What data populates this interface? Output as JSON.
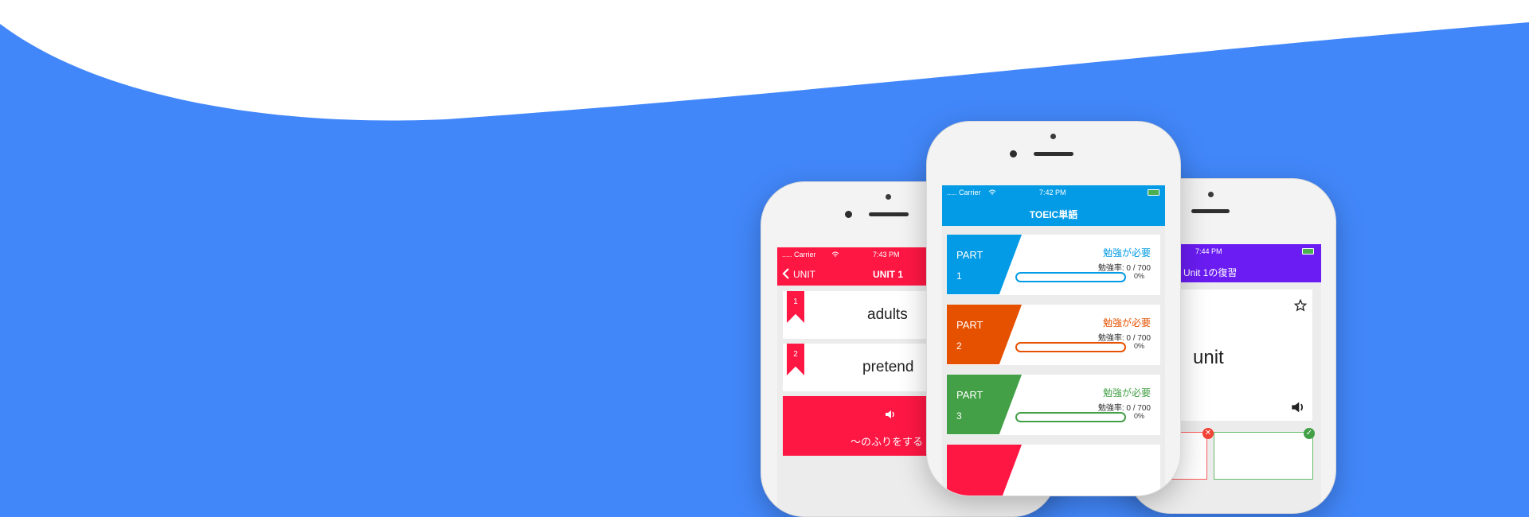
{
  "left_phone": {
    "status": {
      "carrier": "..... Carrier",
      "time": "7:43 PM"
    },
    "nav": {
      "back_label": "UNIT",
      "title": "UNIT 1",
      "color": "#ff1744"
    },
    "words": [
      {
        "number": "1",
        "word": "adults"
      },
      {
        "number": "2",
        "word": "pretend"
      }
    ],
    "meaning": "〜のふりをする"
  },
  "center_phone": {
    "status": {
      "carrier": "..... Carrier",
      "time": "7:42 PM"
    },
    "nav": {
      "title": "TOEIC単語",
      "color": "#039be5"
    },
    "parts": [
      {
        "label": "PART",
        "number": "1",
        "status": "勉強が必要",
        "rate": "勉強率: 0 / 700",
        "percent": "0%",
        "progress": 0,
        "color": "#039be5"
      },
      {
        "label": "PART",
        "number": "2",
        "status": "勉強が必要",
        "rate": "勉強率: 0 / 700",
        "percent": "0%",
        "progress": 0,
        "color": "#e65100"
      },
      {
        "label": "PART",
        "number": "3",
        "status": "勉強が必要",
        "rate": "勉強率: 0 / 700",
        "percent": "0%",
        "progress": 0,
        "color": "#43a047"
      }
    ],
    "part4_color": "#ff1744"
  },
  "right_phone": {
    "status": {
      "time": "7:44 PM"
    },
    "nav": {
      "title": "Unit 1の復習",
      "color": "#6a1cf2"
    },
    "card": {
      "word": "unit"
    }
  },
  "icons": [
    "chevron-left-icon",
    "wifi-icon",
    "battery-icon",
    "speaker-icon",
    "star-icon",
    "cross-icon",
    "check-icon",
    "bookmark-icon"
  ],
  "colors": {
    "background": "#4287fa",
    "wave": "#ffffff"
  }
}
